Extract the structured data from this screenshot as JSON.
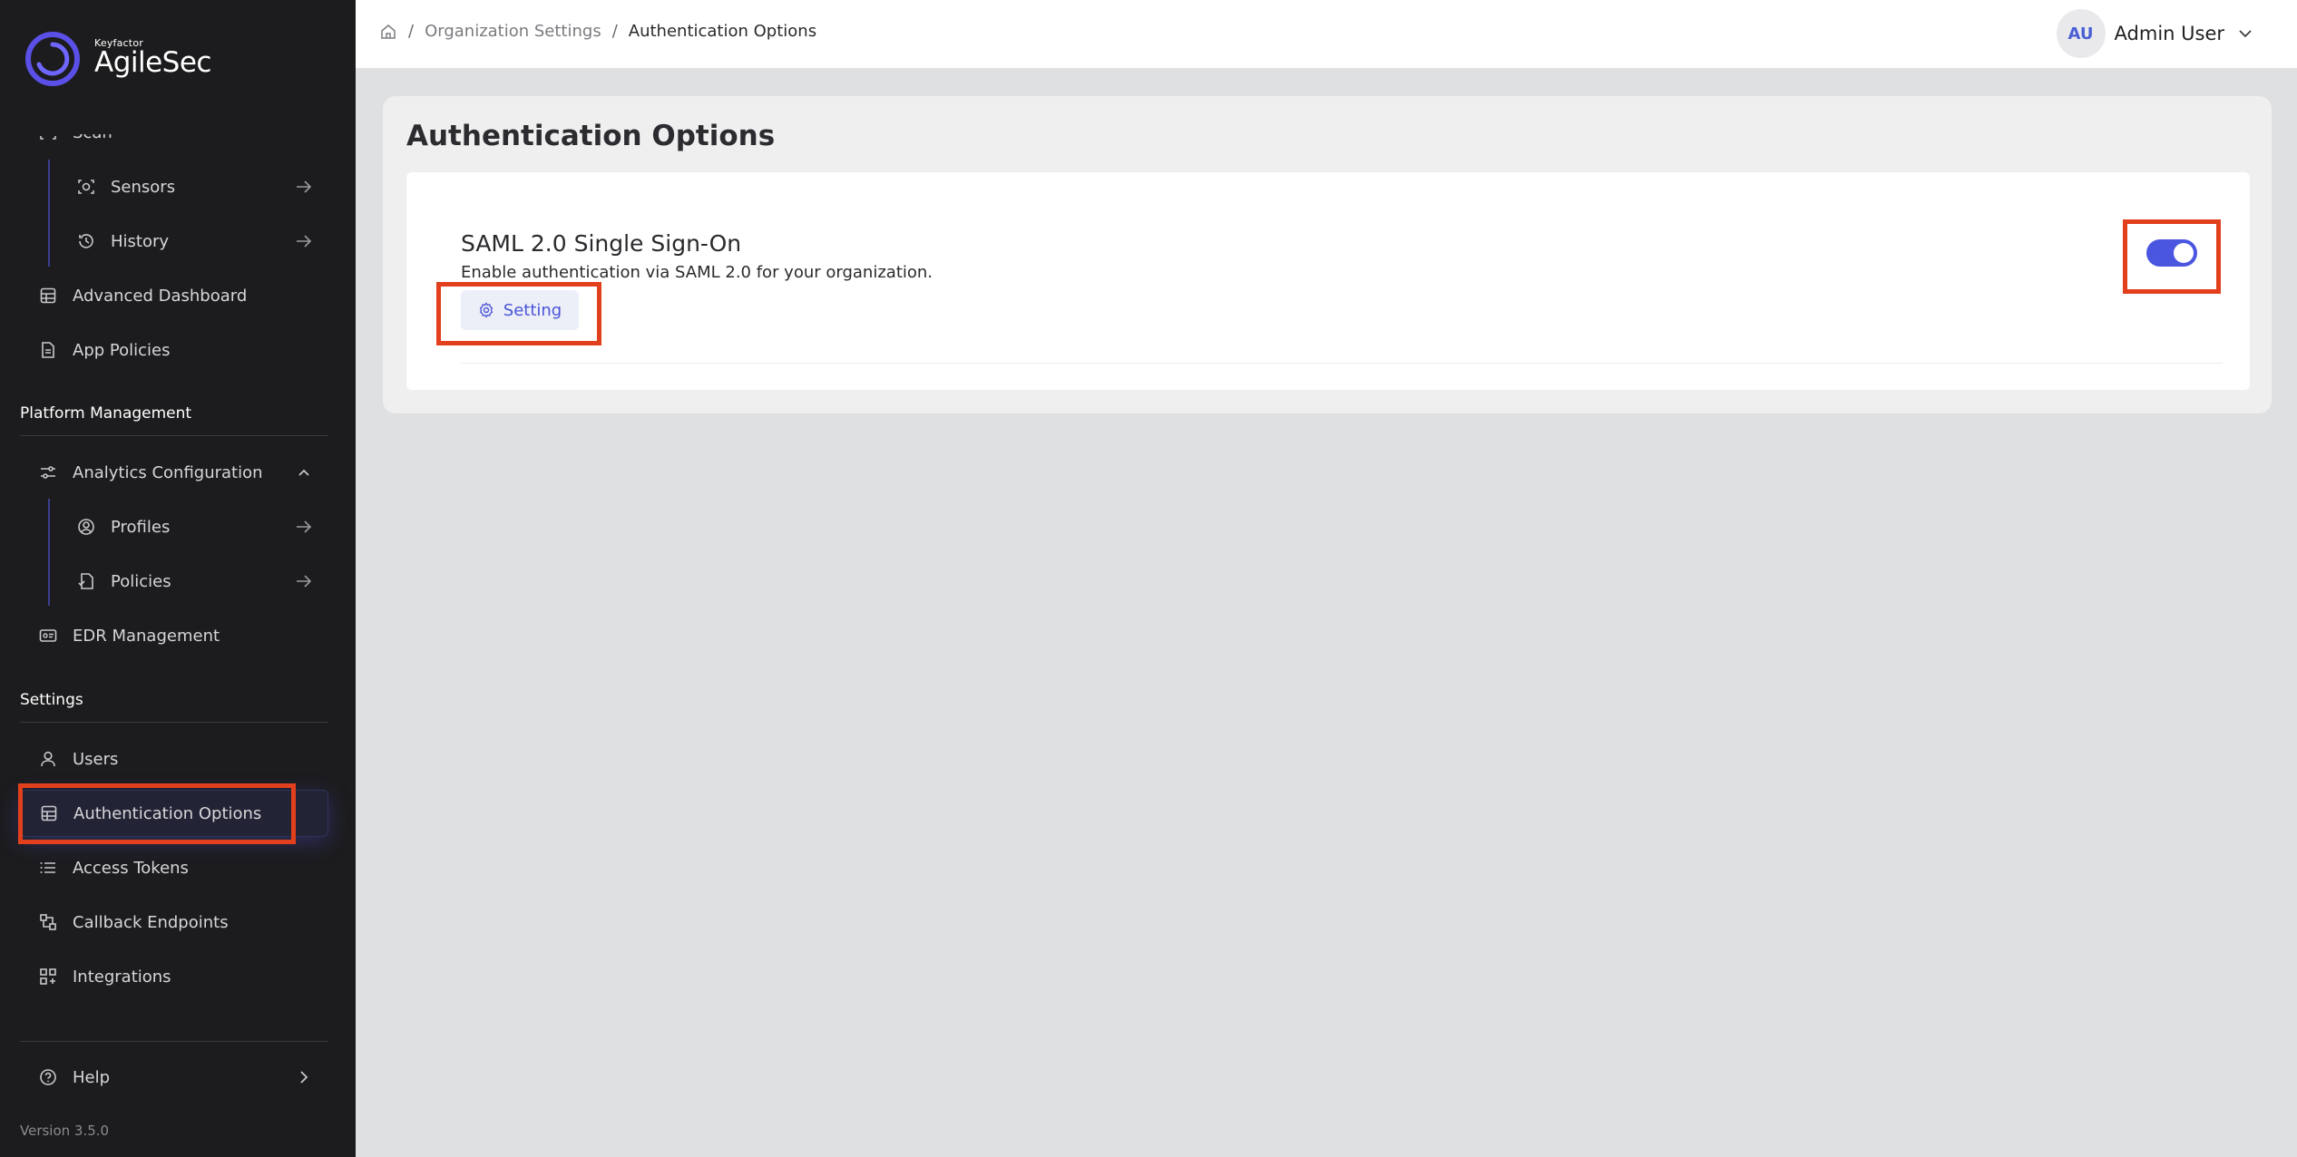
{
  "brand": {
    "small": "Keyfactor",
    "name": "AgileSec"
  },
  "sidebar": {
    "scan_partial": "Scan",
    "items": [
      {
        "label": "Sensors",
        "icon": "sensors-icon"
      },
      {
        "label": "History",
        "icon": "history-icon"
      },
      {
        "label": "Advanced Dashboard",
        "icon": "dashboard-icon"
      },
      {
        "label": "App Policies",
        "icon": "file-icon"
      }
    ],
    "platform_title": "Platform Management",
    "platform_items": [
      {
        "label": "Analytics Configuration",
        "icon": "sliders-icon"
      },
      {
        "label": "Profiles",
        "icon": "user-circle-icon"
      },
      {
        "label": "Policies",
        "icon": "file-check-icon"
      },
      {
        "label": "EDR Management",
        "icon": "id-card-icon"
      }
    ],
    "settings_title": "Settings",
    "settings_items": [
      {
        "label": "Users",
        "icon": "user-icon"
      },
      {
        "label": "Authentication Options",
        "icon": "table-icon"
      },
      {
        "label": "Access Tokens",
        "icon": "list-icon"
      },
      {
        "label": "Callback Endpoints",
        "icon": "endpoints-icon"
      },
      {
        "label": "Integrations",
        "icon": "integrations-icon"
      }
    ],
    "help": "Help",
    "version": "Version 3.5.0"
  },
  "topbar": {
    "breadcrumb": [
      "Organization Settings",
      "Authentication Options"
    ],
    "separator": "/",
    "user_initials": "AU",
    "user_name": "Admin User"
  },
  "main": {
    "title": "Authentication Options",
    "feature": {
      "title": "SAML 2.0 Single Sign-On",
      "description": "Enable authentication via SAML 2.0 for your organization.",
      "button": "Setting",
      "enabled": true
    }
  },
  "colors": {
    "accent": "#4a55e0",
    "highlight": "#e2401c",
    "sidebar_bg": "#1c1c1e"
  }
}
